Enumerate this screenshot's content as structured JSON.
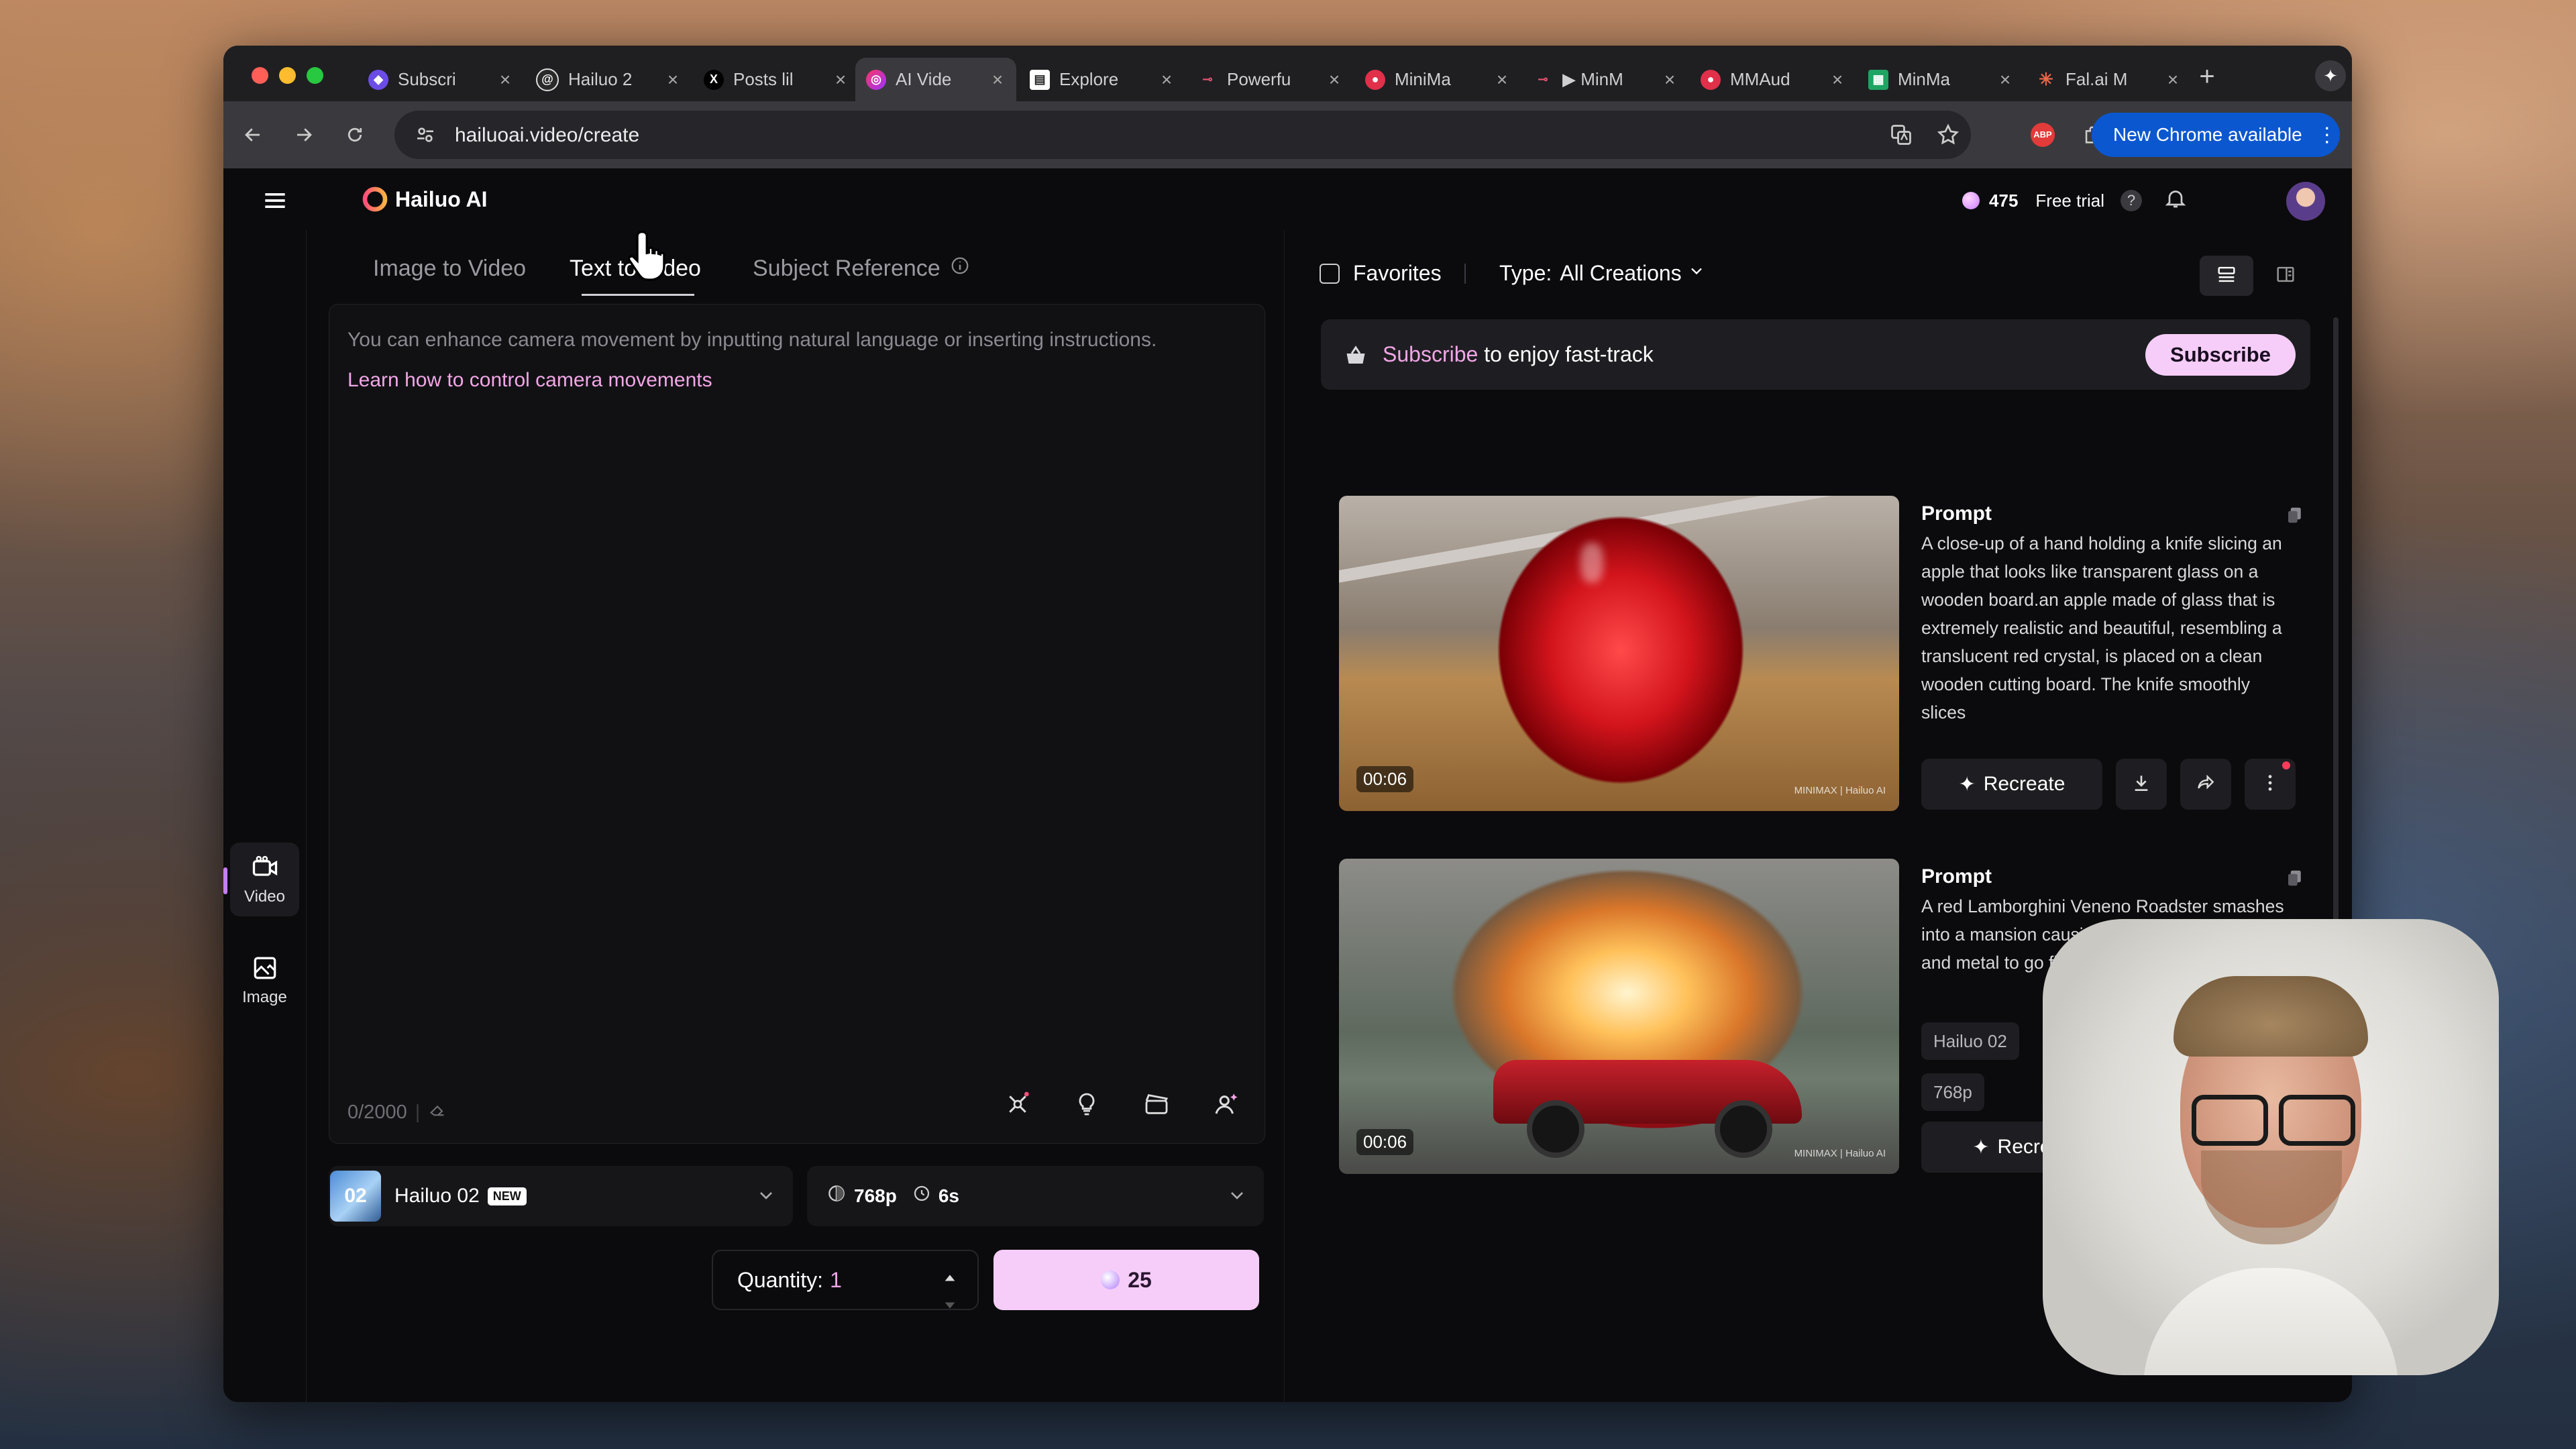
{
  "browser": {
    "tabs": [
      {
        "label": "Subscri",
        "favicon": "purple-app-icon",
        "color": "#6b4de6"
      },
      {
        "label": "Hailuo 2",
        "favicon": "threads-icon",
        "color": "#2a2a2a"
      },
      {
        "label": "Posts lil",
        "favicon": "x-icon",
        "color": "#000000"
      },
      {
        "label": "AI Vide",
        "favicon": "hailuo-icon",
        "color": "#d94d8a"
      },
      {
        "label": "Explore",
        "favicon": "document-icon",
        "color": "#ffffff"
      },
      {
        "label": "Powerfu",
        "favicon": "link-icon",
        "color": "#e0506e"
      },
      {
        "label": "MiniMa",
        "favicon": "minimax-icon",
        "color": "#e0304a"
      },
      {
        "label": "▶ MinM",
        "favicon": "link-icon",
        "color": "#e0506e"
      },
      {
        "label": "MMAud",
        "favicon": "minimax-icon",
        "color": "#e0304a"
      },
      {
        "label": "MinMa",
        "favicon": "sheets-icon",
        "color": "#1fa463"
      },
      {
        "label": "Fal.ai M",
        "favicon": "fal-icon",
        "color": "#e8664a"
      }
    ],
    "active_tab_index": 3,
    "url": "hailuoai.video/create",
    "new_chrome_label": "New Chrome available"
  },
  "app": {
    "brand": "Hailuo AI",
    "credits": "475",
    "free_trial": "Free trial",
    "help": "?"
  },
  "rail": {
    "items": [
      {
        "label": "Video",
        "icon": "video-icon",
        "active": true
      },
      {
        "label": "Image",
        "icon": "image-icon",
        "active": false
      }
    ]
  },
  "create": {
    "tabs": [
      {
        "label": "Image to Video",
        "active": false
      },
      {
        "label": "Text to Video",
        "active": true
      },
      {
        "label": "Subject Reference",
        "active": false
      }
    ],
    "placeholder": "You can enhance camera movement by inputting natural language or inserting instructions.",
    "learn_link": "Learn how to control camera movements",
    "char_count": "0/2000",
    "model": {
      "name": "Hailuo 02",
      "badge": "NEW"
    },
    "resolution": "768p",
    "duration": "6s",
    "quantity_label": "Quantity:",
    "quantity_value": "1",
    "generate_cost": "25"
  },
  "gallery": {
    "favorites_label": "Favorites",
    "type_label": "Type:",
    "type_value": "All Creations",
    "banner": {
      "highlight": "Subscribe",
      "text": " to enjoy fast-track",
      "button": "Subscribe"
    },
    "cards": [
      {
        "duration": "00:06",
        "prompt_title": "Prompt",
        "prompt_text": "A close-up of a hand holding a knife slicing an apple that looks like transparent glass on a wooden board.an apple made of glass that is extremely realistic and beautiful, resembling a translucent red crystal, is placed on a clean wooden cutting board. The knife smoothly slices",
        "recreate_label": "Recreate",
        "watermark": "MINIMAX | Hailuo AI"
      },
      {
        "duration": "00:06",
        "prompt_title": "Prompt",
        "prompt_text": "A red Lamborghini Veneno Roadster smashes into a mansion causing a massive explosion and metal to go flying in all directi",
        "chips": [
          "Hailuo 02",
          "768p"
        ],
        "recreate_label": "Recre",
        "watermark": "MINIMAX | Hailuo AI"
      }
    ]
  },
  "colors": {
    "accent_pink": "#f2a6e6",
    "generate_bg": "#f6cdf8",
    "chrome_blue": "#0b57d0"
  }
}
